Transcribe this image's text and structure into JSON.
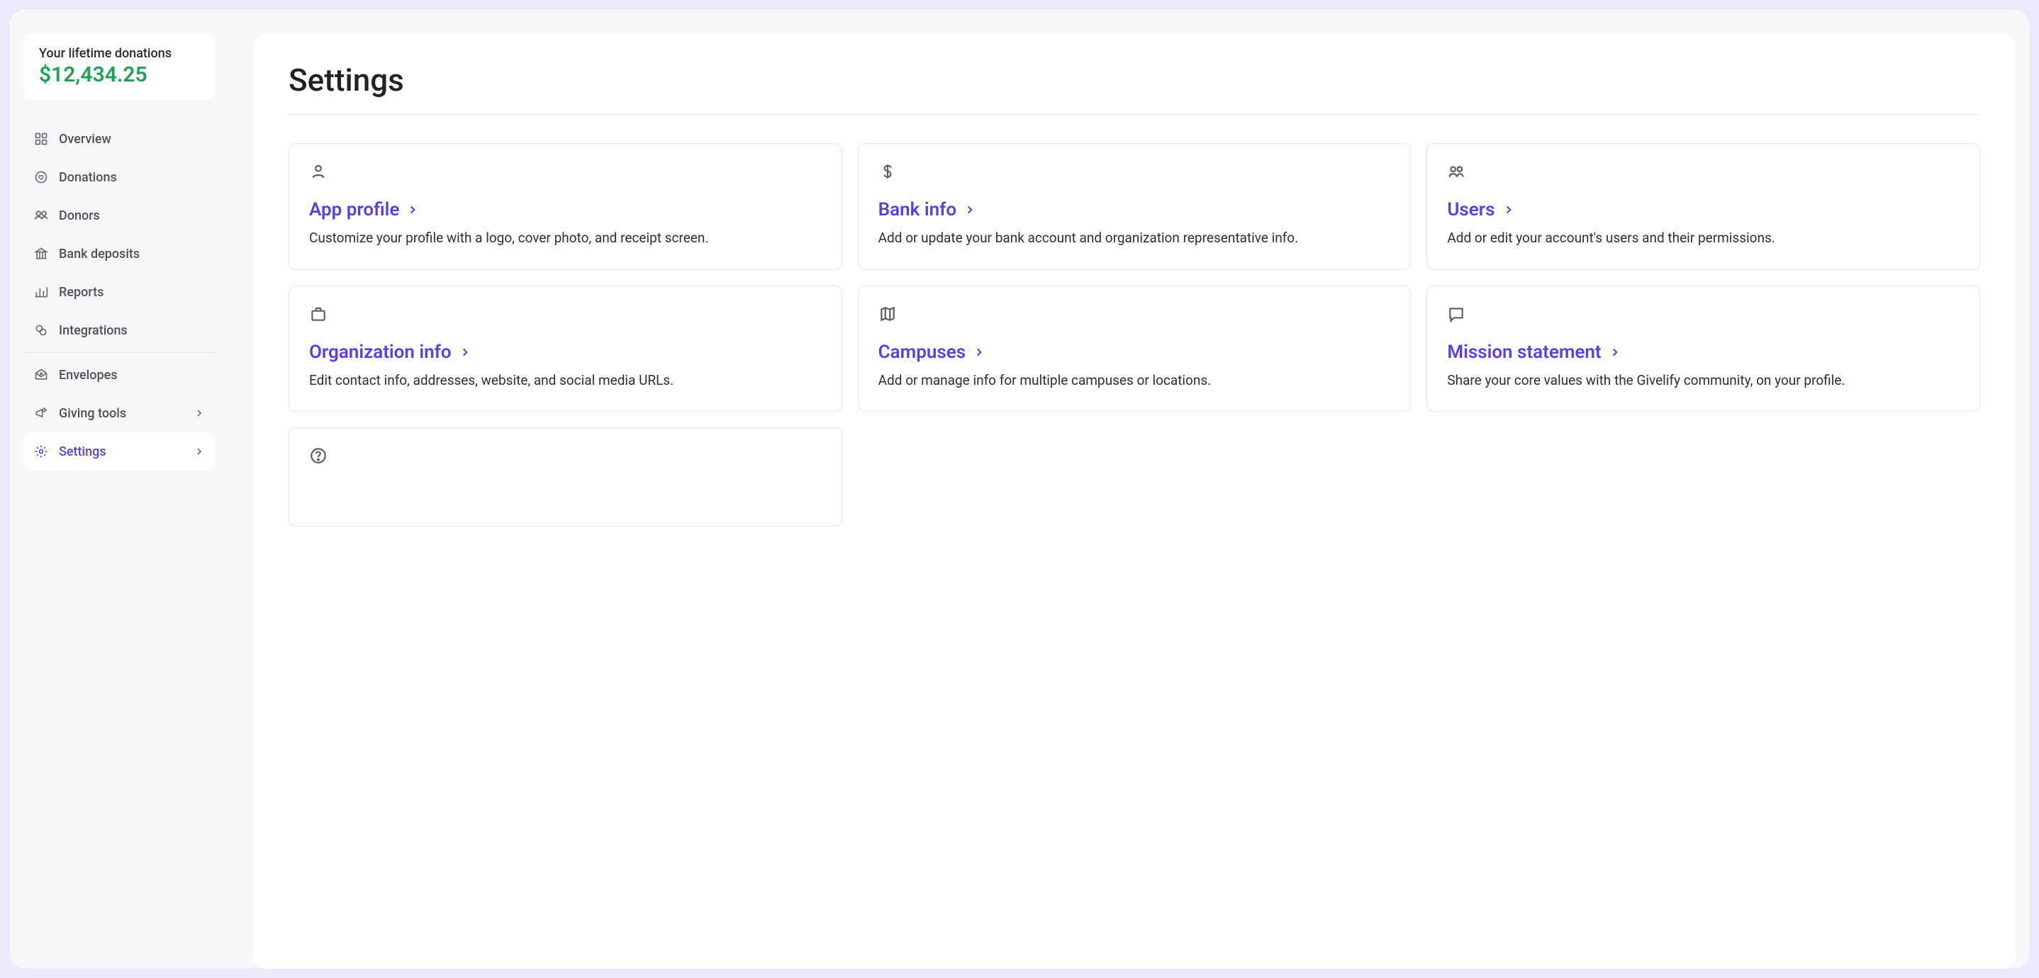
{
  "sidebar": {
    "donations_label": "Your lifetime donations",
    "donations_value": "$12,434.25",
    "nav": [
      {
        "label": "Overview"
      },
      {
        "label": "Donations"
      },
      {
        "label": "Donors"
      },
      {
        "label": "Bank deposits"
      },
      {
        "label": "Reports"
      },
      {
        "label": "Integrations"
      },
      {
        "label": "Envelopes"
      },
      {
        "label": "Giving tools"
      },
      {
        "label": "Settings"
      }
    ]
  },
  "page": {
    "title": "Settings"
  },
  "cards": {
    "app_profile": {
      "title": "App profile",
      "desc": "Customize your profile with a logo, cover photo, and receipt screen."
    },
    "bank_info": {
      "title": "Bank info",
      "desc": "Add or update your bank account and organization representative info."
    },
    "users": {
      "title": "Users",
      "desc": "Add or edit your account's users and their permissions."
    },
    "org_info": {
      "title": "Organization info",
      "desc": "Edit contact info, addresses, website, and social media URLs."
    },
    "campuses": {
      "title": "Campuses",
      "desc": "Add or manage info for multiple campuses or locations."
    },
    "mission": {
      "title": "Mission statement",
      "desc": "Share your core values with the Givelify community, on your profile."
    }
  }
}
